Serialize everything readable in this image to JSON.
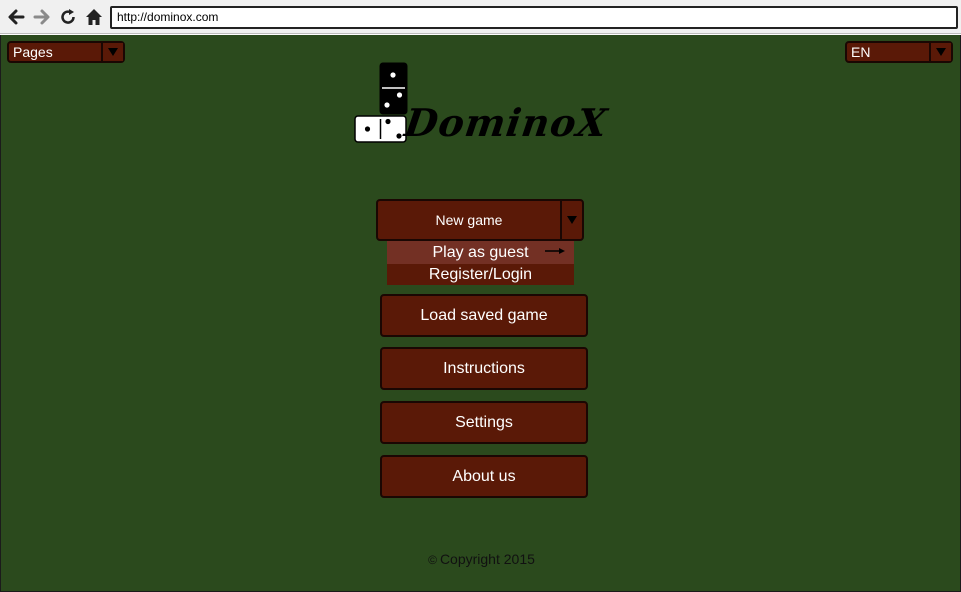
{
  "browser": {
    "url": "http://dominox.com",
    "icons": [
      "back-arrow-icon",
      "forward-arrow-icon",
      "reload-icon",
      "home-icon"
    ]
  },
  "header": {
    "pages_select": "Pages",
    "language_select": "EN"
  },
  "logo": {
    "text": "DominoX"
  },
  "menu": {
    "new_game": "New game",
    "dropdown": {
      "play_as_guest": "Play as guest",
      "register_login": "Register/Login"
    },
    "load_saved_game": "Load saved game",
    "instructions": "Instructions",
    "settings": "Settings",
    "about_us": "About us"
  },
  "footer": {
    "copyright_symbol": "©",
    "copyright": "Copyright 2015"
  },
  "colors": {
    "background": "#2b4a1d",
    "button": "#5a1907",
    "button_hover": "#733024",
    "border": "#1a0703"
  }
}
